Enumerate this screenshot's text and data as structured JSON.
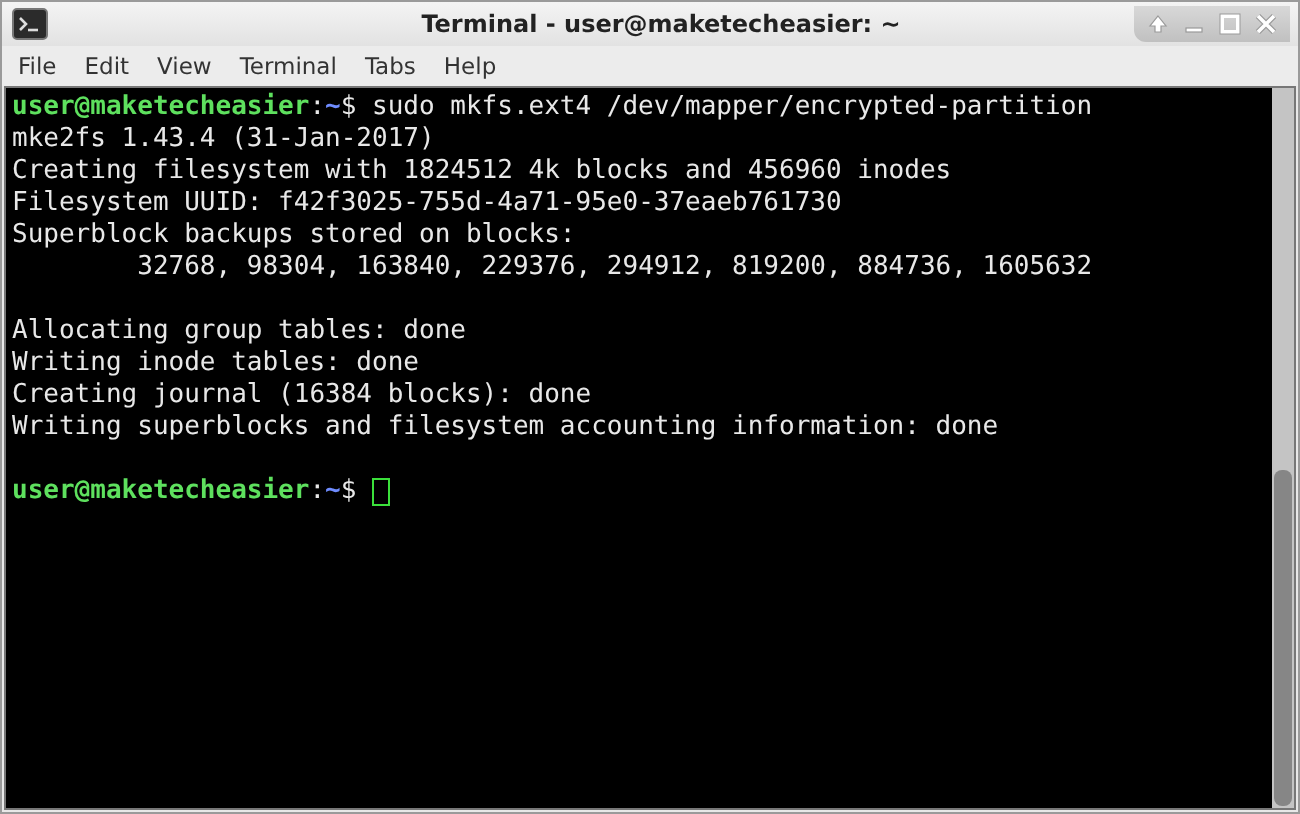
{
  "window": {
    "title": "Terminal - user@maketecheasier: ~"
  },
  "menu": [
    "File",
    "Edit",
    "View",
    "Terminal",
    "Tabs",
    "Help"
  ],
  "terminal": {
    "lines": [
      {
        "kind": "prompt",
        "user": "user@maketecheasier",
        "sep": ":",
        "path": "~",
        "symbol": "$",
        "command": "sudo mkfs.ext4 /dev/mapper/encrypted-partition"
      },
      {
        "kind": "output",
        "text": "mke2fs 1.43.4 (31-Jan-2017)"
      },
      {
        "kind": "output",
        "text": "Creating filesystem with 1824512 4k blocks and 456960 inodes"
      },
      {
        "kind": "output",
        "text": "Filesystem UUID: f42f3025-755d-4a71-95e0-37eaeb761730"
      },
      {
        "kind": "output",
        "text": "Superblock backups stored on blocks:"
      },
      {
        "kind": "output",
        "text": "        32768, 98304, 163840, 229376, 294912, 819200, 884736, 1605632"
      },
      {
        "kind": "blank"
      },
      {
        "kind": "output",
        "text": "Allocating group tables: done"
      },
      {
        "kind": "output",
        "text": "Writing inode tables: done"
      },
      {
        "kind": "output",
        "text": "Creating journal (16384 blocks): done"
      },
      {
        "kind": "output",
        "text": "Writing superblocks and filesystem accounting information: done"
      },
      {
        "kind": "blank"
      },
      {
        "kind": "prompt",
        "user": "user@maketecheasier",
        "sep": ":",
        "path": "~",
        "symbol": "$",
        "cursor": true
      }
    ]
  }
}
